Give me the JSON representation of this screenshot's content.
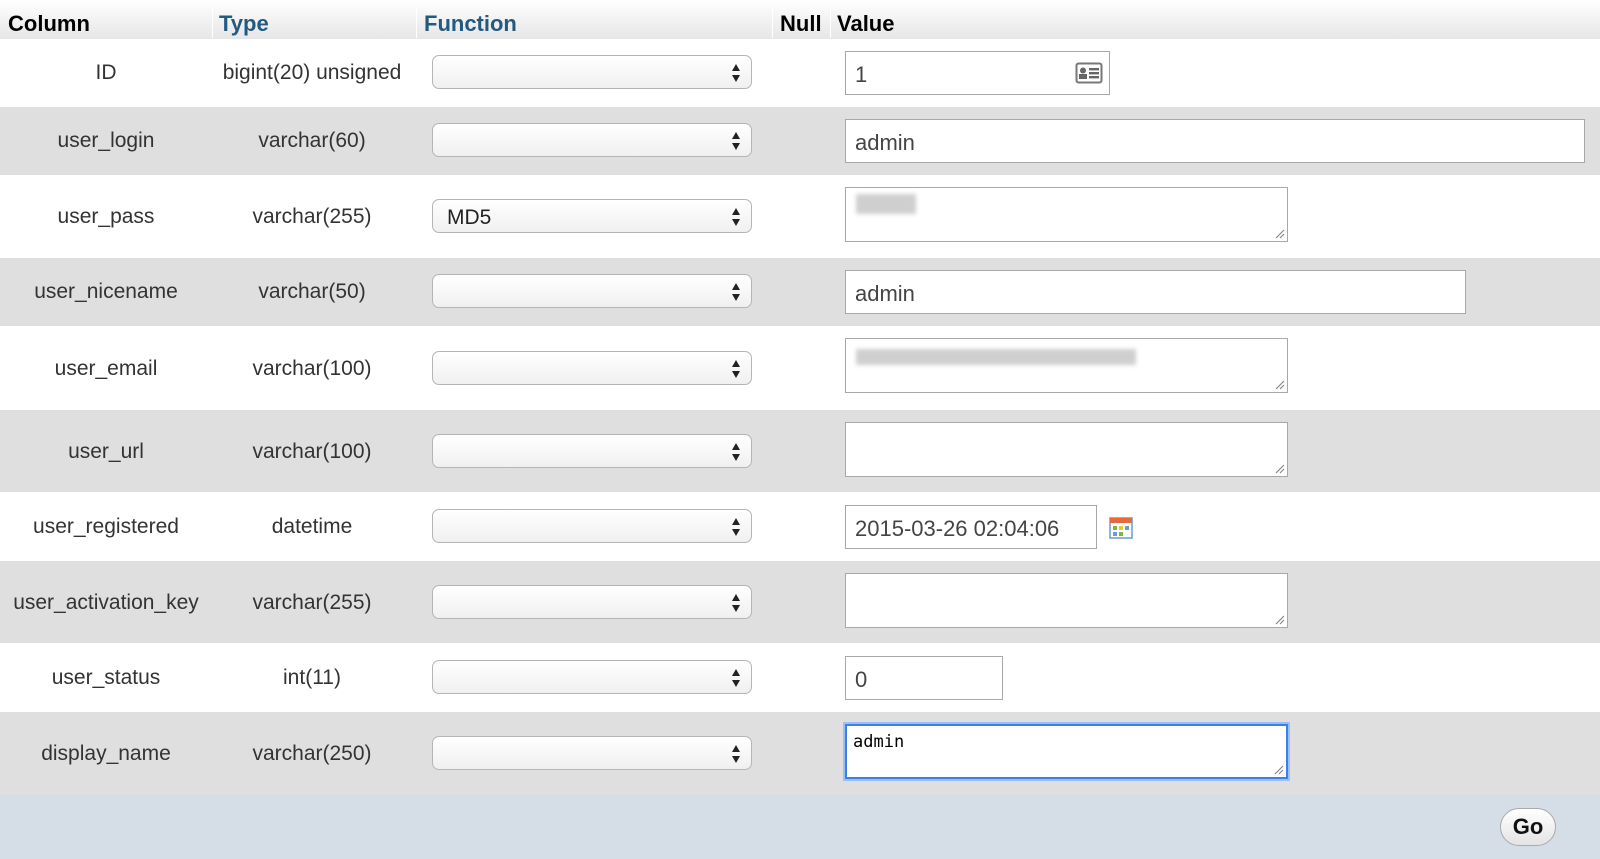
{
  "header": {
    "column": "Column",
    "type": "Type",
    "function": "Function",
    "null": "Null",
    "value": "Value"
  },
  "rows": [
    {
      "name": "ID",
      "type": "bigint(20) unsigned",
      "function": "",
      "value": "1"
    },
    {
      "name": "user_login",
      "type": "varchar(60)",
      "function": "",
      "value": "admin"
    },
    {
      "name": "user_pass",
      "type": "varchar(255)",
      "function": "MD5",
      "value": ""
    },
    {
      "name": "user_nicename",
      "type": "varchar(50)",
      "function": "",
      "value": "admin"
    },
    {
      "name": "user_email",
      "type": "varchar(100)",
      "function": "",
      "value": ""
    },
    {
      "name": "user_url",
      "type": "varchar(100)",
      "function": "",
      "value": ""
    },
    {
      "name": "user_registered",
      "type": "datetime",
      "function": "",
      "value": "2015-03-26 02:04:06"
    },
    {
      "name": "user_activation_key",
      "type": "varchar(255)",
      "function": "",
      "value": ""
    },
    {
      "name": "user_status",
      "type": "int(11)",
      "function": "",
      "value": "0"
    },
    {
      "name": "display_name",
      "type": "varchar(250)",
      "function": "",
      "value": "admin"
    }
  ],
  "go_label": "Go",
  "colors": {
    "link": "#235a81",
    "even_row": "#dfdfdf",
    "footer": "#d5dde6",
    "focus": "#3d7fe8"
  }
}
